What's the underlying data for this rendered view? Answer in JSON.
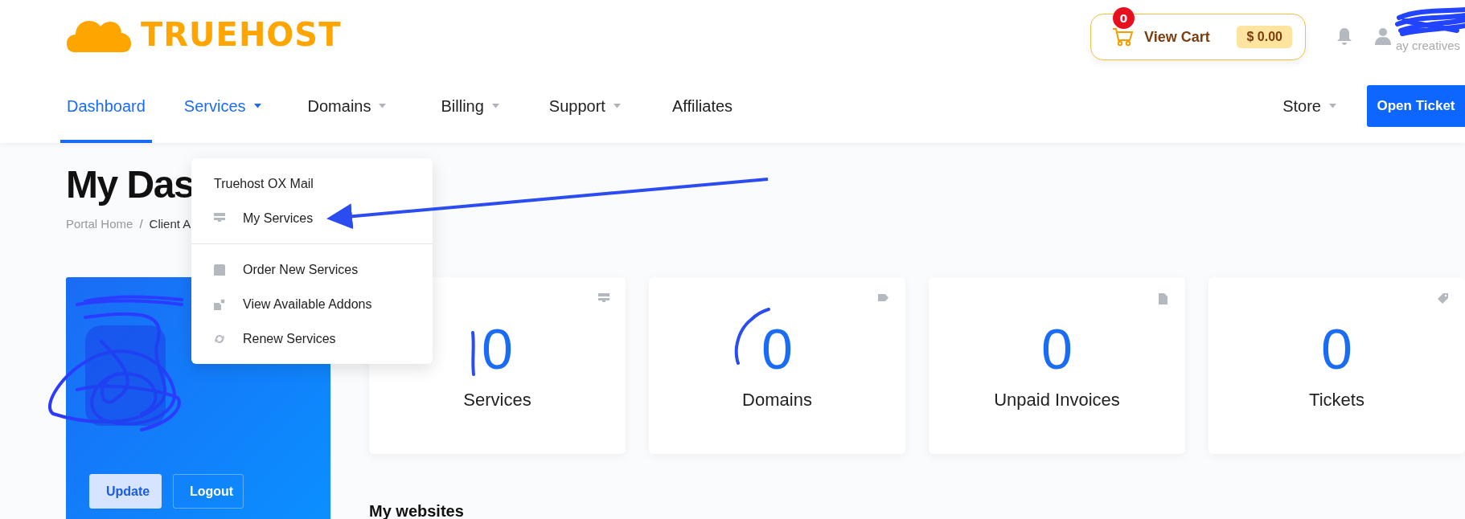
{
  "logo": {
    "text": "TRUEHOST"
  },
  "cart": {
    "count": "0",
    "label": "View Cart",
    "total": "$ 0.00"
  },
  "user": {
    "name": "ay creatives"
  },
  "nav": {
    "items": [
      {
        "label": "Dashboard",
        "selected": true,
        "dropdown": false,
        "expanded": false
      },
      {
        "label": "Services",
        "selected": false,
        "dropdown": true,
        "expanded": true
      },
      {
        "label": "Domains",
        "selected": false,
        "dropdown": true,
        "expanded": false
      },
      {
        "label": "Billing",
        "selected": false,
        "dropdown": true,
        "expanded": false
      },
      {
        "label": "Support",
        "selected": false,
        "dropdown": true,
        "expanded": false
      },
      {
        "label": "Affiliates",
        "selected": false,
        "dropdown": false,
        "expanded": false
      }
    ],
    "right": [
      {
        "label": "Store",
        "dropdown": true
      }
    ],
    "button": "Open Ticket"
  },
  "services_menu": {
    "items": [
      {
        "kind": "link",
        "label": "Truehost OX Mail"
      },
      {
        "kind": "icon-link",
        "label": "My Services"
      },
      {
        "kind": "divider"
      },
      {
        "kind": "icon-link",
        "label": "Order New Services"
      },
      {
        "kind": "icon-link",
        "label": "View Available Addons"
      },
      {
        "kind": "icon-link",
        "label": "Renew Services"
      }
    ]
  },
  "page": {
    "title": "My Das",
    "breadcrumb": [
      "Portal Home",
      "Client A"
    ],
    "breadcrumb_separator": "/"
  },
  "profile": {
    "buttons": [
      {
        "label": "Update",
        "kind": "primary"
      },
      {
        "label": "Logout",
        "kind": "outline"
      }
    ]
  },
  "stats": [
    {
      "value": "0",
      "label": "Services"
    },
    {
      "value": "0",
      "label": "Domains"
    },
    {
      "value": "0",
      "label": "Unpaid Invoices"
    },
    {
      "value": "0",
      "label": "Tickets"
    }
  ],
  "section": {
    "title": "My websites"
  }
}
